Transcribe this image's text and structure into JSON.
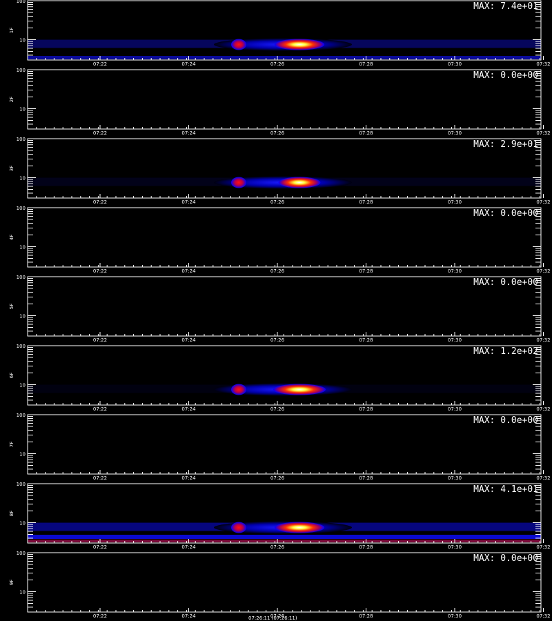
{
  "chart_data": {
    "type": "heatmap",
    "ylim": [
      3,
      100
    ],
    "y_scale": "log",
    "y_tick_labels": [
      "100",
      "10"
    ],
    "x_tick_labels": [
      "07:22",
      "07:24",
      "07:26",
      "07:28",
      "07:30",
      "07:32"
    ],
    "colormap": [
      "#000000",
      "#0000ff",
      "#ff0000",
      "#ffff00",
      "#ffffff"
    ],
    "bottom_label": "07:26:11 (07:26:11)",
    "panels": [
      {
        "ylabel": "1F",
        "max_label": "MAX: 7.4e+01",
        "intensity": 0.95,
        "floor": "#0a0a9a"
      },
      {
        "ylabel": "2F",
        "max_label": "MAX: 0.0e+00",
        "intensity": 0
      },
      {
        "ylabel": "3F",
        "max_label": "MAX: 2.9e+01",
        "intensity": 0.8,
        "floor": "#03032a"
      },
      {
        "ylabel": "4F",
        "max_label": "MAX: 0.0e+00",
        "intensity": 0
      },
      {
        "ylabel": "5F",
        "max_label": "MAX: 0.0e+00",
        "intensity": 0
      },
      {
        "ylabel": "6F",
        "max_label": "MAX: 1.2e+02",
        "intensity": 1.0,
        "floor": "#02021a"
      },
      {
        "ylabel": "7F",
        "max_label": "MAX: 0.0e+00",
        "intensity": 0
      },
      {
        "ylabel": "8F",
        "max_label": "MAX: 4.1e+01",
        "intensity": 0.95,
        "floor": "#0a0ad0",
        "floor2": "#7a0a3a"
      },
      {
        "ylabel": "9F",
        "max_label": "MAX: 0.0e+00",
        "intensity": 0
      }
    ]
  }
}
